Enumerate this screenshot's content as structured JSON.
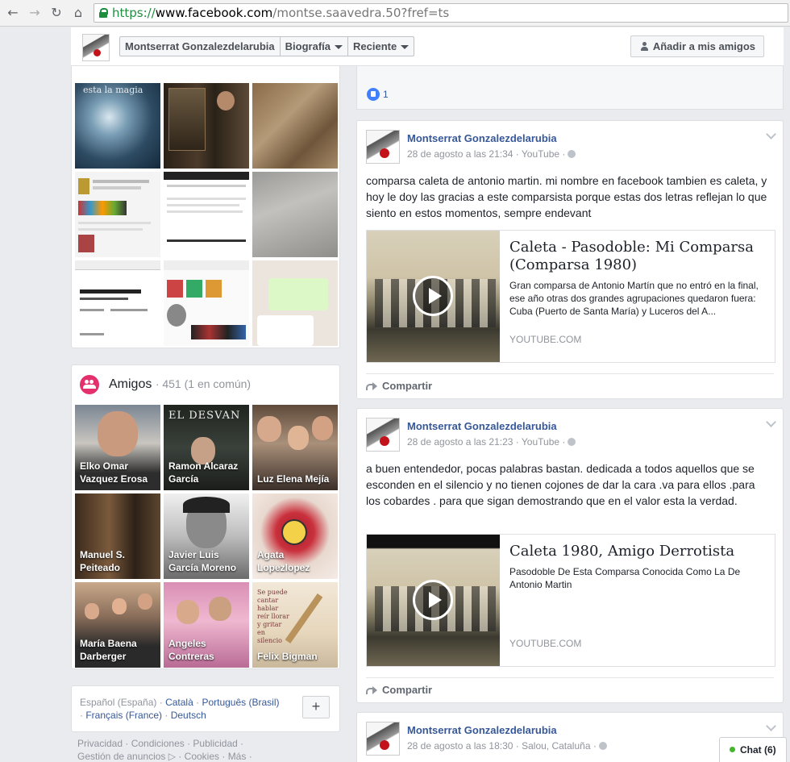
{
  "browser": {
    "url_scheme": "https://",
    "url_host": "www.facebook.com",
    "url_path": "/montse.saavedra.50?fref=ts"
  },
  "header": {
    "name": "Montserrat Gonzalezdelarubia",
    "tab_timeline": "Biografía",
    "tab_recent": "Reciente",
    "add_friend": "Añadir a mis amigos"
  },
  "photos": {
    "caption_first": "esta la magia"
  },
  "friends": {
    "title": "Amigos",
    "meta": "· 451 (1 en común)",
    "list": [
      {
        "name": "Elko Omar Vazquez Erosa"
      },
      {
        "name": "Ramon Alcaraz García"
      },
      {
        "name": "Luz Elena Mejía"
      },
      {
        "name": "Manuel S. Peiteado"
      },
      {
        "name": "Javier Luis García Moreno"
      },
      {
        "name": "Agata Lopezlopez"
      },
      {
        "name": "María Baena Darberger"
      },
      {
        "name": "Angeles Contreras"
      },
      {
        "name": "Felix Bigman"
      }
    ]
  },
  "languages": {
    "current": "Español (España)",
    "options": [
      "Català",
      "Português (Brasil)",
      "Français (France)",
      "Deutsch"
    ],
    "sep": "·"
  },
  "footer": {
    "links": [
      "Privacidad",
      "Condiciones",
      "Publicidad",
      "Gestión de anuncios",
      "Cookies",
      "Más"
    ]
  },
  "prev_post": {
    "likes": "1"
  },
  "posts": [
    {
      "author": "Montserrat Gonzalezdelarubia",
      "meta": "28 de agosto a las 21:34 · YouTube ·",
      "text": "comparsa caleta de antonio martin. mi nombre en facebook tambien es caleta, y hoy le doy las gracias a este comparsista porque estas dos letras reflejan lo que siento en estos momentos, sempre endevant",
      "link_title": "Caleta - Pasodoble: Mi Comparsa (Comparsa 1980)",
      "link_desc": "Gran comparsa de Antonio Martín que no entró en la final, ese año otras dos grandes agrupaciones quedaron fuera: Cuba (Puerto de Santa María) y Luceros del A...",
      "link_domain": "YOUTUBE.COM",
      "share": "Compartir"
    },
    {
      "author": "Montserrat Gonzalezdelarubia",
      "meta": "28 de agosto a las 21:23 · YouTube ·",
      "text": "a buen entendedor, pocas palabras bastan. dedicada a todos aquellos que se esconden en el silencio y no tienen cojones de dar la cara .va para ellos .para los cobardes . para que sigan demostrando que en el valor esta la verdad.",
      "link_title": "Caleta 1980, Amigo Derrotista",
      "link_desc": "Pasodoble De Esta Comparsa Conocida Como La De Antonio Martin",
      "link_domain": "YOUTUBE.COM",
      "share": "Compartir"
    },
    {
      "author": "Montserrat Gonzalezdelarubia",
      "meta": "28 de agosto a las 18:30 · Salou, Cataluña ·"
    }
  ],
  "chat": {
    "label": "Chat (6)"
  },
  "colors": {
    "link_blue": "#365899",
    "page_bg": "#e9ebee",
    "secure_green": "#1e8e3e",
    "online_green": "#42b72a",
    "friends_pink": "#e4306c"
  }
}
